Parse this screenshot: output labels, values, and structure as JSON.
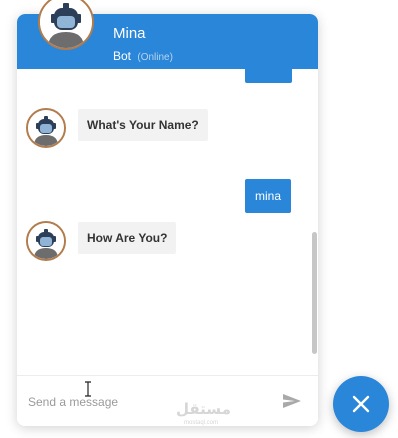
{
  "header": {
    "bot_name": "Mina",
    "role": "Bot",
    "status": "(Online)"
  },
  "messages": [
    {
      "from": "user",
      "text": ""
    },
    {
      "from": "bot",
      "text": "What's Your Name?"
    },
    {
      "from": "user",
      "text": "mina"
    },
    {
      "from": "bot",
      "text": "How Are You?"
    }
  ],
  "composer": {
    "placeholder": "Send a message",
    "value": ""
  },
  "icons": {
    "send": "send-icon",
    "close": "close-icon",
    "avatar": "robot-avatar-icon"
  },
  "watermark": {
    "text": "مستقل",
    "sub": "mostaql.com"
  },
  "colors": {
    "accent": "#2a86d8",
    "bot_bubble": "#f2f2f2",
    "avatar_ring": "#b27c4c"
  }
}
